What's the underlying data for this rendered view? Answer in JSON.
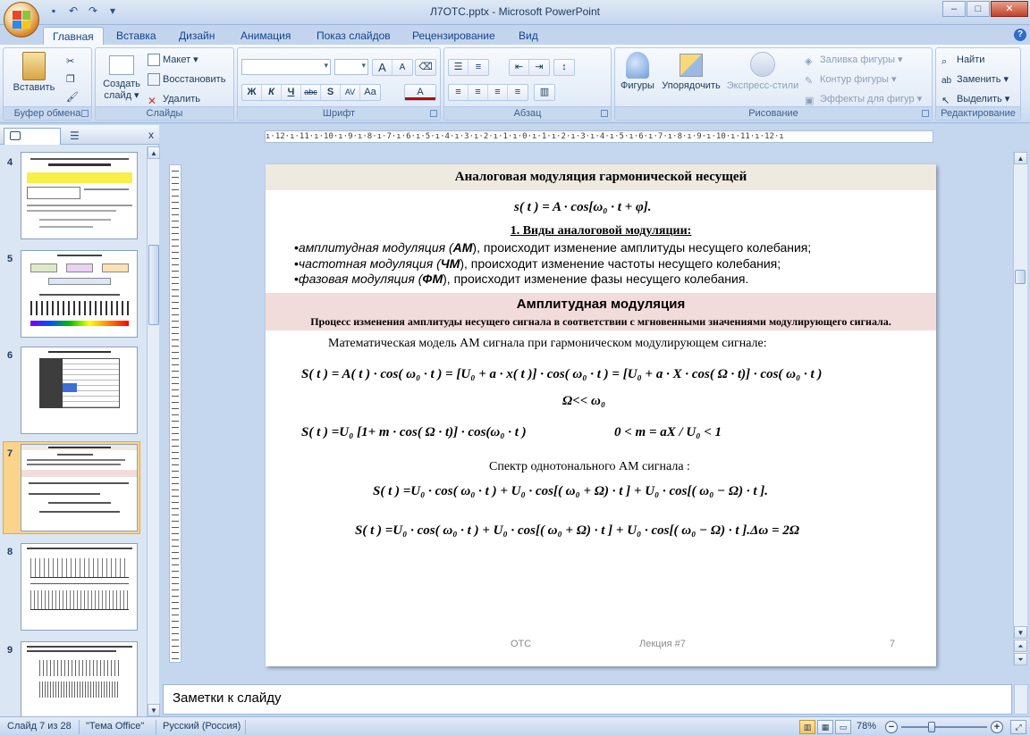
{
  "window": {
    "title": "Л7ОТС.pptx - Microsoft PowerPoint",
    "minimize": "–",
    "maximize": "□",
    "close": "✕"
  },
  "tabs": [
    "Главная",
    "Вставка",
    "Дизайн",
    "Анимация",
    "Показ слайдов",
    "Рецензирование",
    "Вид"
  ],
  "active_tab": "Главная",
  "ribbon": {
    "clipboard": {
      "label": "Буфер обмена",
      "paste": "Вставить"
    },
    "slides": {
      "label": "Слайды",
      "new_slide_line1": "Создать",
      "new_slide_line2": "слайд ▾",
      "layout": "Макет ▾",
      "reset": "Восстановить",
      "delete": "Удалить"
    },
    "font": {
      "label": "Шрифт",
      "grow": "A",
      "shrink": "A",
      "bold": "Ж",
      "italic": "К",
      "underline": "Ч",
      "strike": "abc",
      "shadow": "S",
      "spacing": "AV",
      "case": "Aa",
      "color": "A"
    },
    "paragraph": {
      "label": "Абзац"
    },
    "drawing": {
      "label": "Рисование",
      "shapes": "Фигуры",
      "arrange": "Упорядочить",
      "quick_styles": "Экспресс-стили",
      "fill": "Заливка фигуры ▾",
      "outline": "Контур фигуры ▾",
      "effects": "Эффекты для фигур ▾"
    },
    "editing": {
      "label": "Редактирование",
      "find": "Найти",
      "replace": "Заменить ▾",
      "select": "Выделить ▾"
    }
  },
  "left_pane": {
    "close": "x",
    "slide_numbers": [
      "4",
      "5",
      "6",
      "7",
      "8",
      "9"
    ],
    "selected_slide": "7"
  },
  "ruler": {
    "horizontal": "ı·12·ı·11·ı·10·ı·9·ı·8·ı·7·ı·6·ı·5·ı·4·ı·3·ı·2·ı·1·ı·0·ı·1·ı·2·ı·3·ı·4·ı·5·ı·6·ı·7·ı·8·ı·9·ı·10·ı·11·ı·12·ı"
  },
  "slide": {
    "title": "Аналоговая модуляция гармонической несущей",
    "formula_carrier": "s( t ) = A · cos[ω₀ · t + φ].",
    "types_title": "1. Виды аналоговой модуляции:",
    "bullets": [
      {
        "em": "амплитудная модуляция (",
        "bold": "АМ",
        "rest": "), происходит изменение амплитуды несущего колебания;"
      },
      {
        "em": "частотная модуляция (",
        "bold": "ЧМ",
        "rest": "), происходит изменение частоты несущего колебания;"
      },
      {
        "em": "фазовая модуляция (",
        "bold": "ФМ",
        "rest": "), происходит изменение фазы несущего колебания."
      }
    ],
    "am_title": "Амплитудная модуляция",
    "am_subtitle": "Процесс изменения амплитуды несущего сигнала в соответствии с мгновенными значениями модулирующего сигнала.",
    "math_model": "Математическая модель АМ сигнала при гармоническом модулирующем сигнале:",
    "formula_am": "S( t ) = A( t ) · cos( ω₀ · t ) = [U₀ + a · x( t )] · cos( ω₀ · t ) = [U₀ + a · X · cos( Ω · t)] · cos( ω₀ · t )",
    "formula_cond": "Ω<< ω₀",
    "formula_m": "S( t ) =U₀ [1+ m · cos( Ω · t)] · cos(ω₀ · t )",
    "formula_m_range": "0 < m = aX / U₀ < 1",
    "spectrum_label": "Спектр однотонального  АМ сигнала :",
    "formula_spectrum1": "S( t ) =U₀ · cos( ω₀ · t ) + U₀ · cos[( ω₀ + Ω) · t ] + U₀ · cos[( ω₀ − Ω) · t ].",
    "formula_spectrum2": "S( t ) =U₀ · cos( ω₀ · t ) + U₀ · cos[( ω₀ + Ω) · t ] + U₀ · cos[( ω₀ − Ω) · t ].Δω = 2Ω",
    "footer_left": "ОТС",
    "footer_center": "Лекция #7",
    "footer_right": "7"
  },
  "notes": {
    "placeholder": "Заметки к слайду"
  },
  "status": {
    "slide": "Слайд 7 из 28",
    "theme": "\"Тема Office\"",
    "language": "Русский (Россия)",
    "zoom": "78%",
    "zoom_minus": "−",
    "zoom_plus": "+"
  },
  "colors": {
    "title_band": "#eeeae0",
    "am_band": "#f2dcdb",
    "selection": "#fbd48b",
    "ribbon": "#dde8f6"
  }
}
